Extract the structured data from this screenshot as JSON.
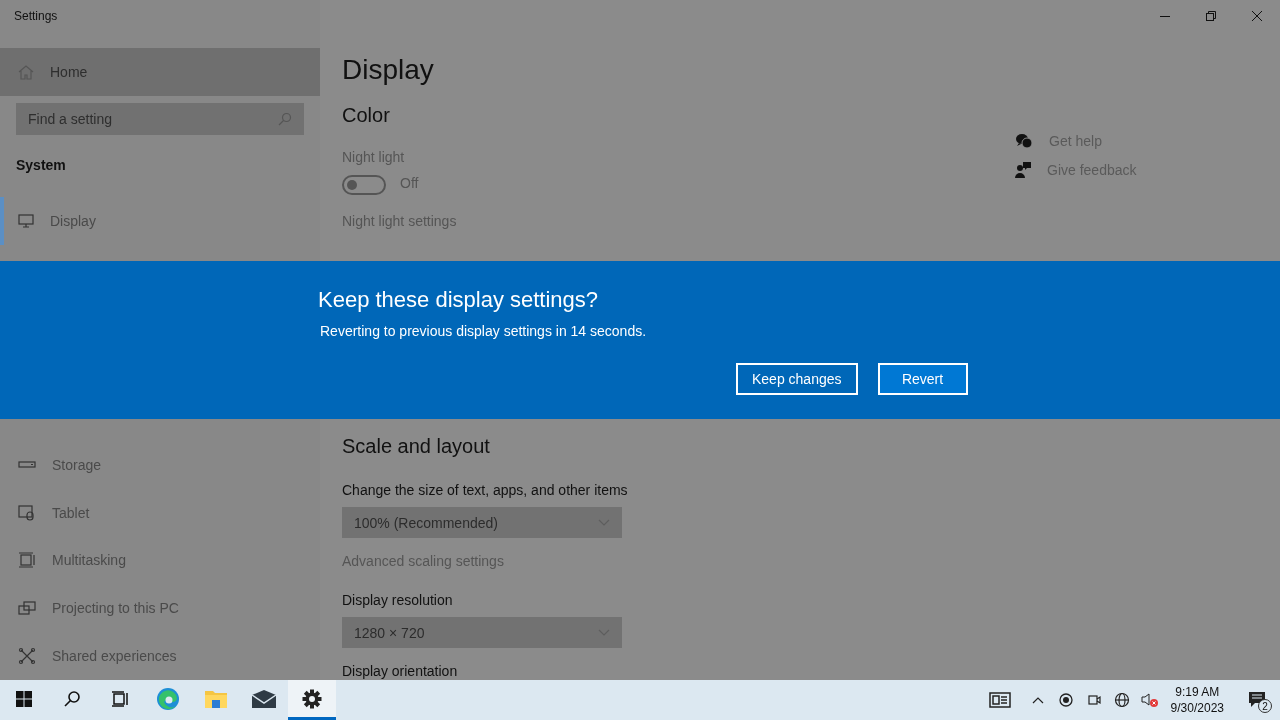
{
  "window": {
    "title": "Settings"
  },
  "sidebar": {
    "home": {
      "label": "Home",
      "selected": false
    },
    "search": {
      "placeholder": "Find a setting"
    },
    "section": "System",
    "top_items": [
      {
        "label": "Display",
        "selected": true
      }
    ],
    "items": [
      {
        "label": "Storage",
        "selected": false
      },
      {
        "label": "Tablet",
        "selected": false
      },
      {
        "label": "Multitasking",
        "selected": false
      },
      {
        "label": "Projecting to this PC",
        "selected": false
      },
      {
        "label": "Shared experiences",
        "selected": false
      }
    ]
  },
  "main": {
    "title": "Display",
    "color_heading": "Color",
    "night_light": {
      "label": "Night light",
      "on": false,
      "state_text": "Off"
    },
    "night_light_link": "Night light settings",
    "help_links": [
      "Get help",
      "Give feedback"
    ],
    "scale": {
      "heading": "Scale and layout",
      "size_label": "Change the size of text, apps, and other items",
      "size_value": "100% (Recommended)",
      "advanced_link": "Advanced scaling settings",
      "resolution_label": "Display resolution",
      "resolution_value": "1280 × 720",
      "orientation_label": "Display orientation"
    }
  },
  "dialog": {
    "title": "Keep these display settings?",
    "message": "Reverting to previous display settings in 14 seconds.",
    "buttons": [
      {
        "label": "Keep changes",
        "default": false
      },
      {
        "label": "Revert",
        "default": true
      }
    ]
  },
  "taskbar": {
    "apps": [
      {
        "selected": false
      },
      {
        "selected": false
      },
      {
        "selected": false
      },
      {
        "selected": false
      },
      {
        "selected": false
      },
      {
        "selected": false
      },
      {
        "selected": true
      }
    ],
    "time": "9:19 AM",
    "date": "9/30/2023",
    "notifications": "2"
  }
}
